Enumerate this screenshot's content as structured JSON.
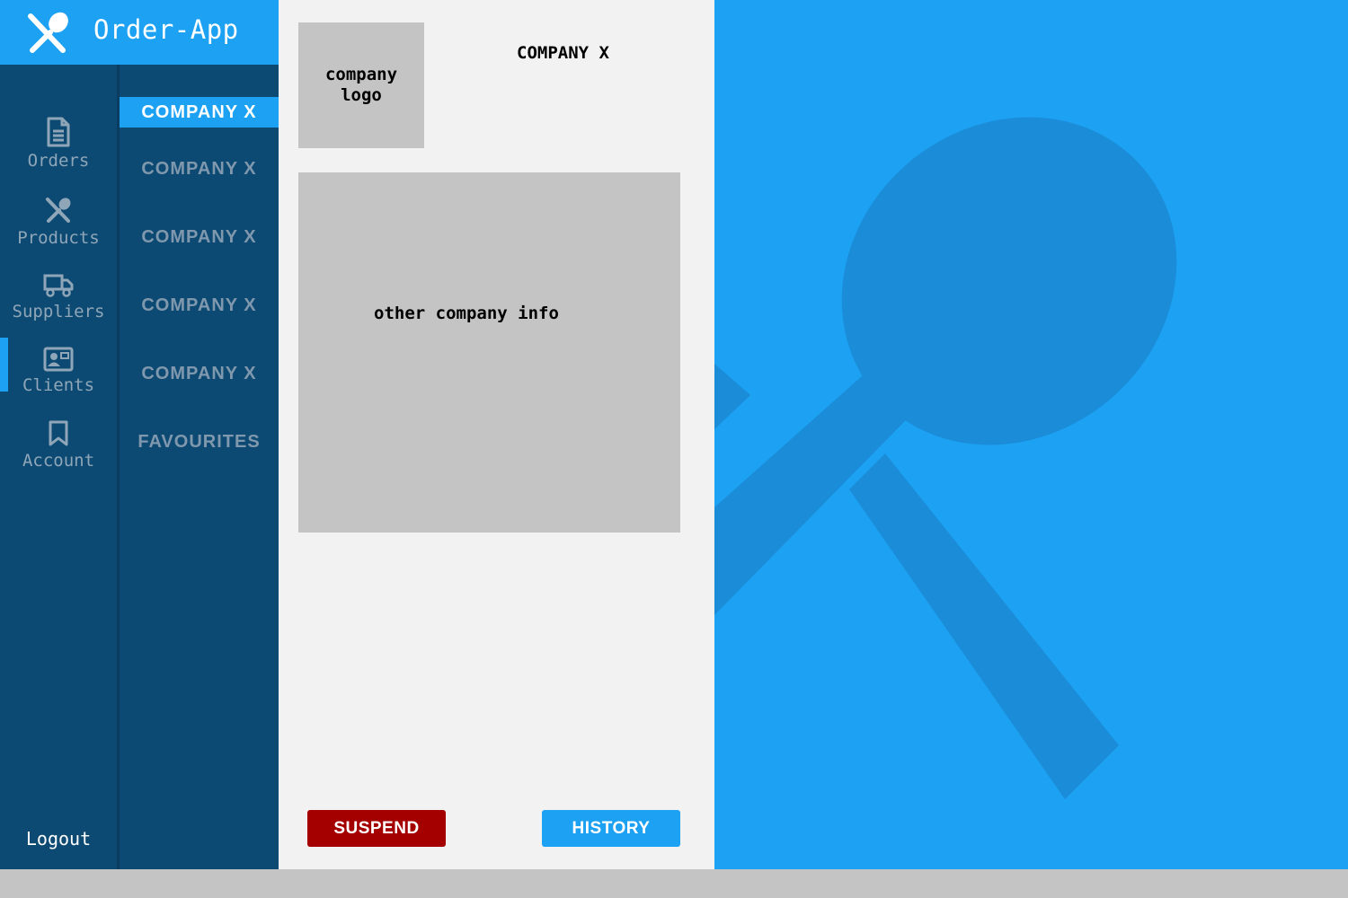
{
  "app": {
    "title": "Order-App",
    "logo_icon": "fork-spoon-icon",
    "accent_color": "#1da1f2",
    "sidebar_color": "#0d4a73",
    "danger_color": "#a50000"
  },
  "nav": {
    "items": [
      {
        "label": "Orders",
        "icon": "document-icon",
        "active": false
      },
      {
        "label": "Products",
        "icon": "fork-spoon-icon",
        "active": false
      },
      {
        "label": "Suppliers",
        "icon": "truck-icon",
        "active": false
      },
      {
        "label": "Clients",
        "icon": "contact-card-icon",
        "active": true
      },
      {
        "label": "Account",
        "icon": "bookmark-icon",
        "active": false
      }
    ],
    "logout_label": "Logout"
  },
  "clients_list": {
    "items": [
      {
        "label": "COMPANY X",
        "active": true
      },
      {
        "label": "COMPANY X",
        "active": false
      },
      {
        "label": "COMPANY X",
        "active": false
      },
      {
        "label": "COMPANY X",
        "active": false
      },
      {
        "label": "COMPANY X",
        "active": false
      },
      {
        "label": "FAVOURITES",
        "active": false
      }
    ]
  },
  "detail": {
    "logo_placeholder": "company logo",
    "company_name": "COMPANY X",
    "info_placeholder": "other company info",
    "suspend_label": "SUSPEND",
    "history_label": "HISTORY"
  }
}
